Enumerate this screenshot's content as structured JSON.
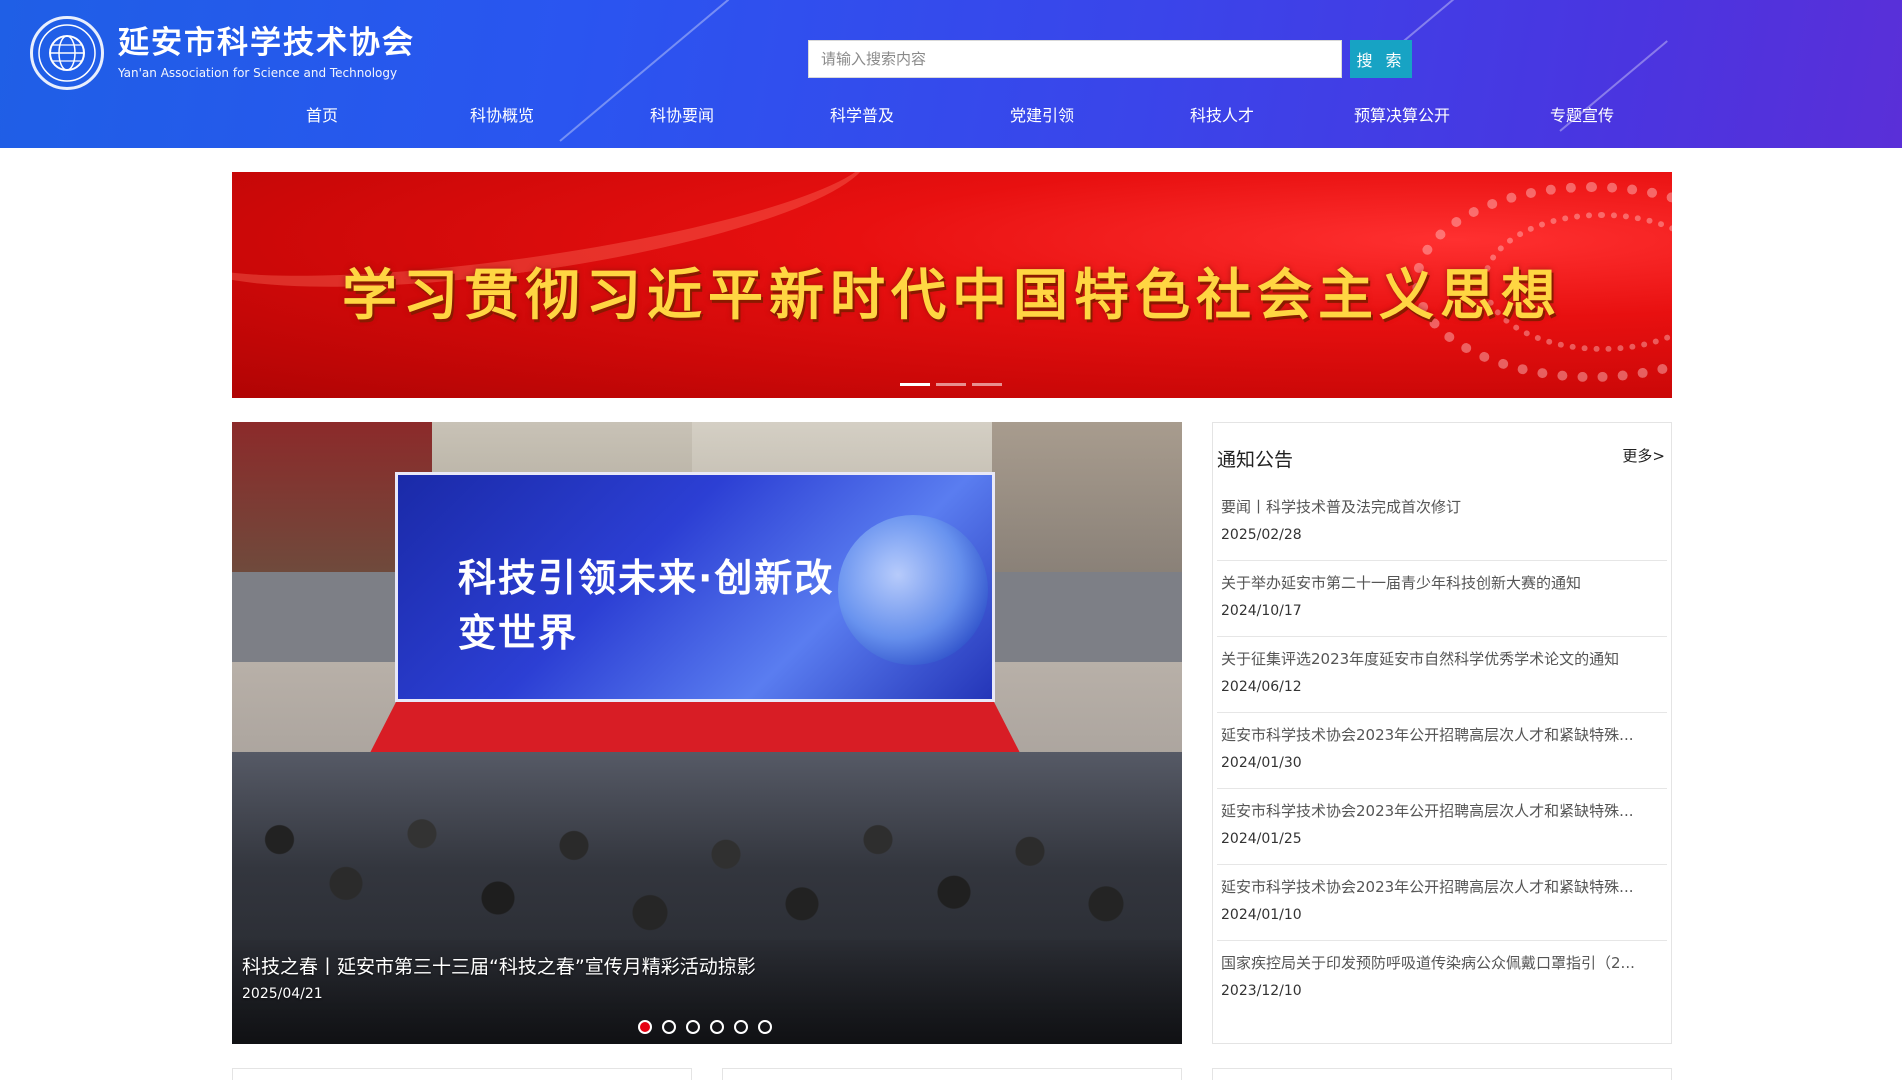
{
  "site": {
    "name_cn": "延安市科学技术协会",
    "name_en": "Yan'an Association for Science and Technology",
    "logo_icon": "association-emblem-icon"
  },
  "search": {
    "placeholder": "请输入搜索内容",
    "value": "",
    "button_label": "搜 索"
  },
  "nav": {
    "items": [
      {
        "label": "首页"
      },
      {
        "label": "科协概览"
      },
      {
        "label": "科协要闻"
      },
      {
        "label": "科学普及"
      },
      {
        "label": "党建引领"
      },
      {
        "label": "科技人才"
      },
      {
        "label": "预算决算公开"
      },
      {
        "label": "专题宣传"
      }
    ]
  },
  "banner": {
    "title": "学习贯彻习近平新时代中国特色社会主义思想",
    "slide_count": 3,
    "active_slide": 1
  },
  "carousel": {
    "backdrop_slogan": "科技引领未来·创新改变世界",
    "caption": "科技之春丨延安市第三十三届“科技之春”宣传月精彩活动掠影",
    "date": "2025/04/21",
    "slide_count": 6,
    "active_slide": 1
  },
  "notices": {
    "title": "通知公告",
    "more_label": "更多>",
    "items": [
      {
        "title": "要闻丨科学技术普及法完成首次修订",
        "date": "2025/02/28"
      },
      {
        "title": "关于举办延安市第二十一届青少年科技创新大赛的通知",
        "date": "2024/10/17"
      },
      {
        "title": "关于征集评选2023年度延安市自然科学优秀学术论文的通知",
        "date": "2024/06/12"
      },
      {
        "title": "延安市科学技术协会2023年公开招聘高层次人才和紧缺特殊...",
        "date": "2024/01/30"
      },
      {
        "title": "延安市科学技术协会2023年公开招聘高层次人才和紧缺特殊...",
        "date": "2024/01/25"
      },
      {
        "title": "延安市科学技术协会2023年公开招聘高层次人才和紧缺特殊...",
        "date": "2024/01/10"
      },
      {
        "title": "国家疾控局关于印发预防呼吸道传染病公众佩戴口罩指引（2...",
        "date": "2023/12/10"
      }
    ]
  },
  "colors": {
    "header_gradient_start": "#1f5fe6",
    "header_gradient_end": "#5a2fd8",
    "search_button": "#17a3c4",
    "banner_red": "#e81010",
    "banner_text": "#ffd642",
    "active_dot": "#e60012"
  }
}
